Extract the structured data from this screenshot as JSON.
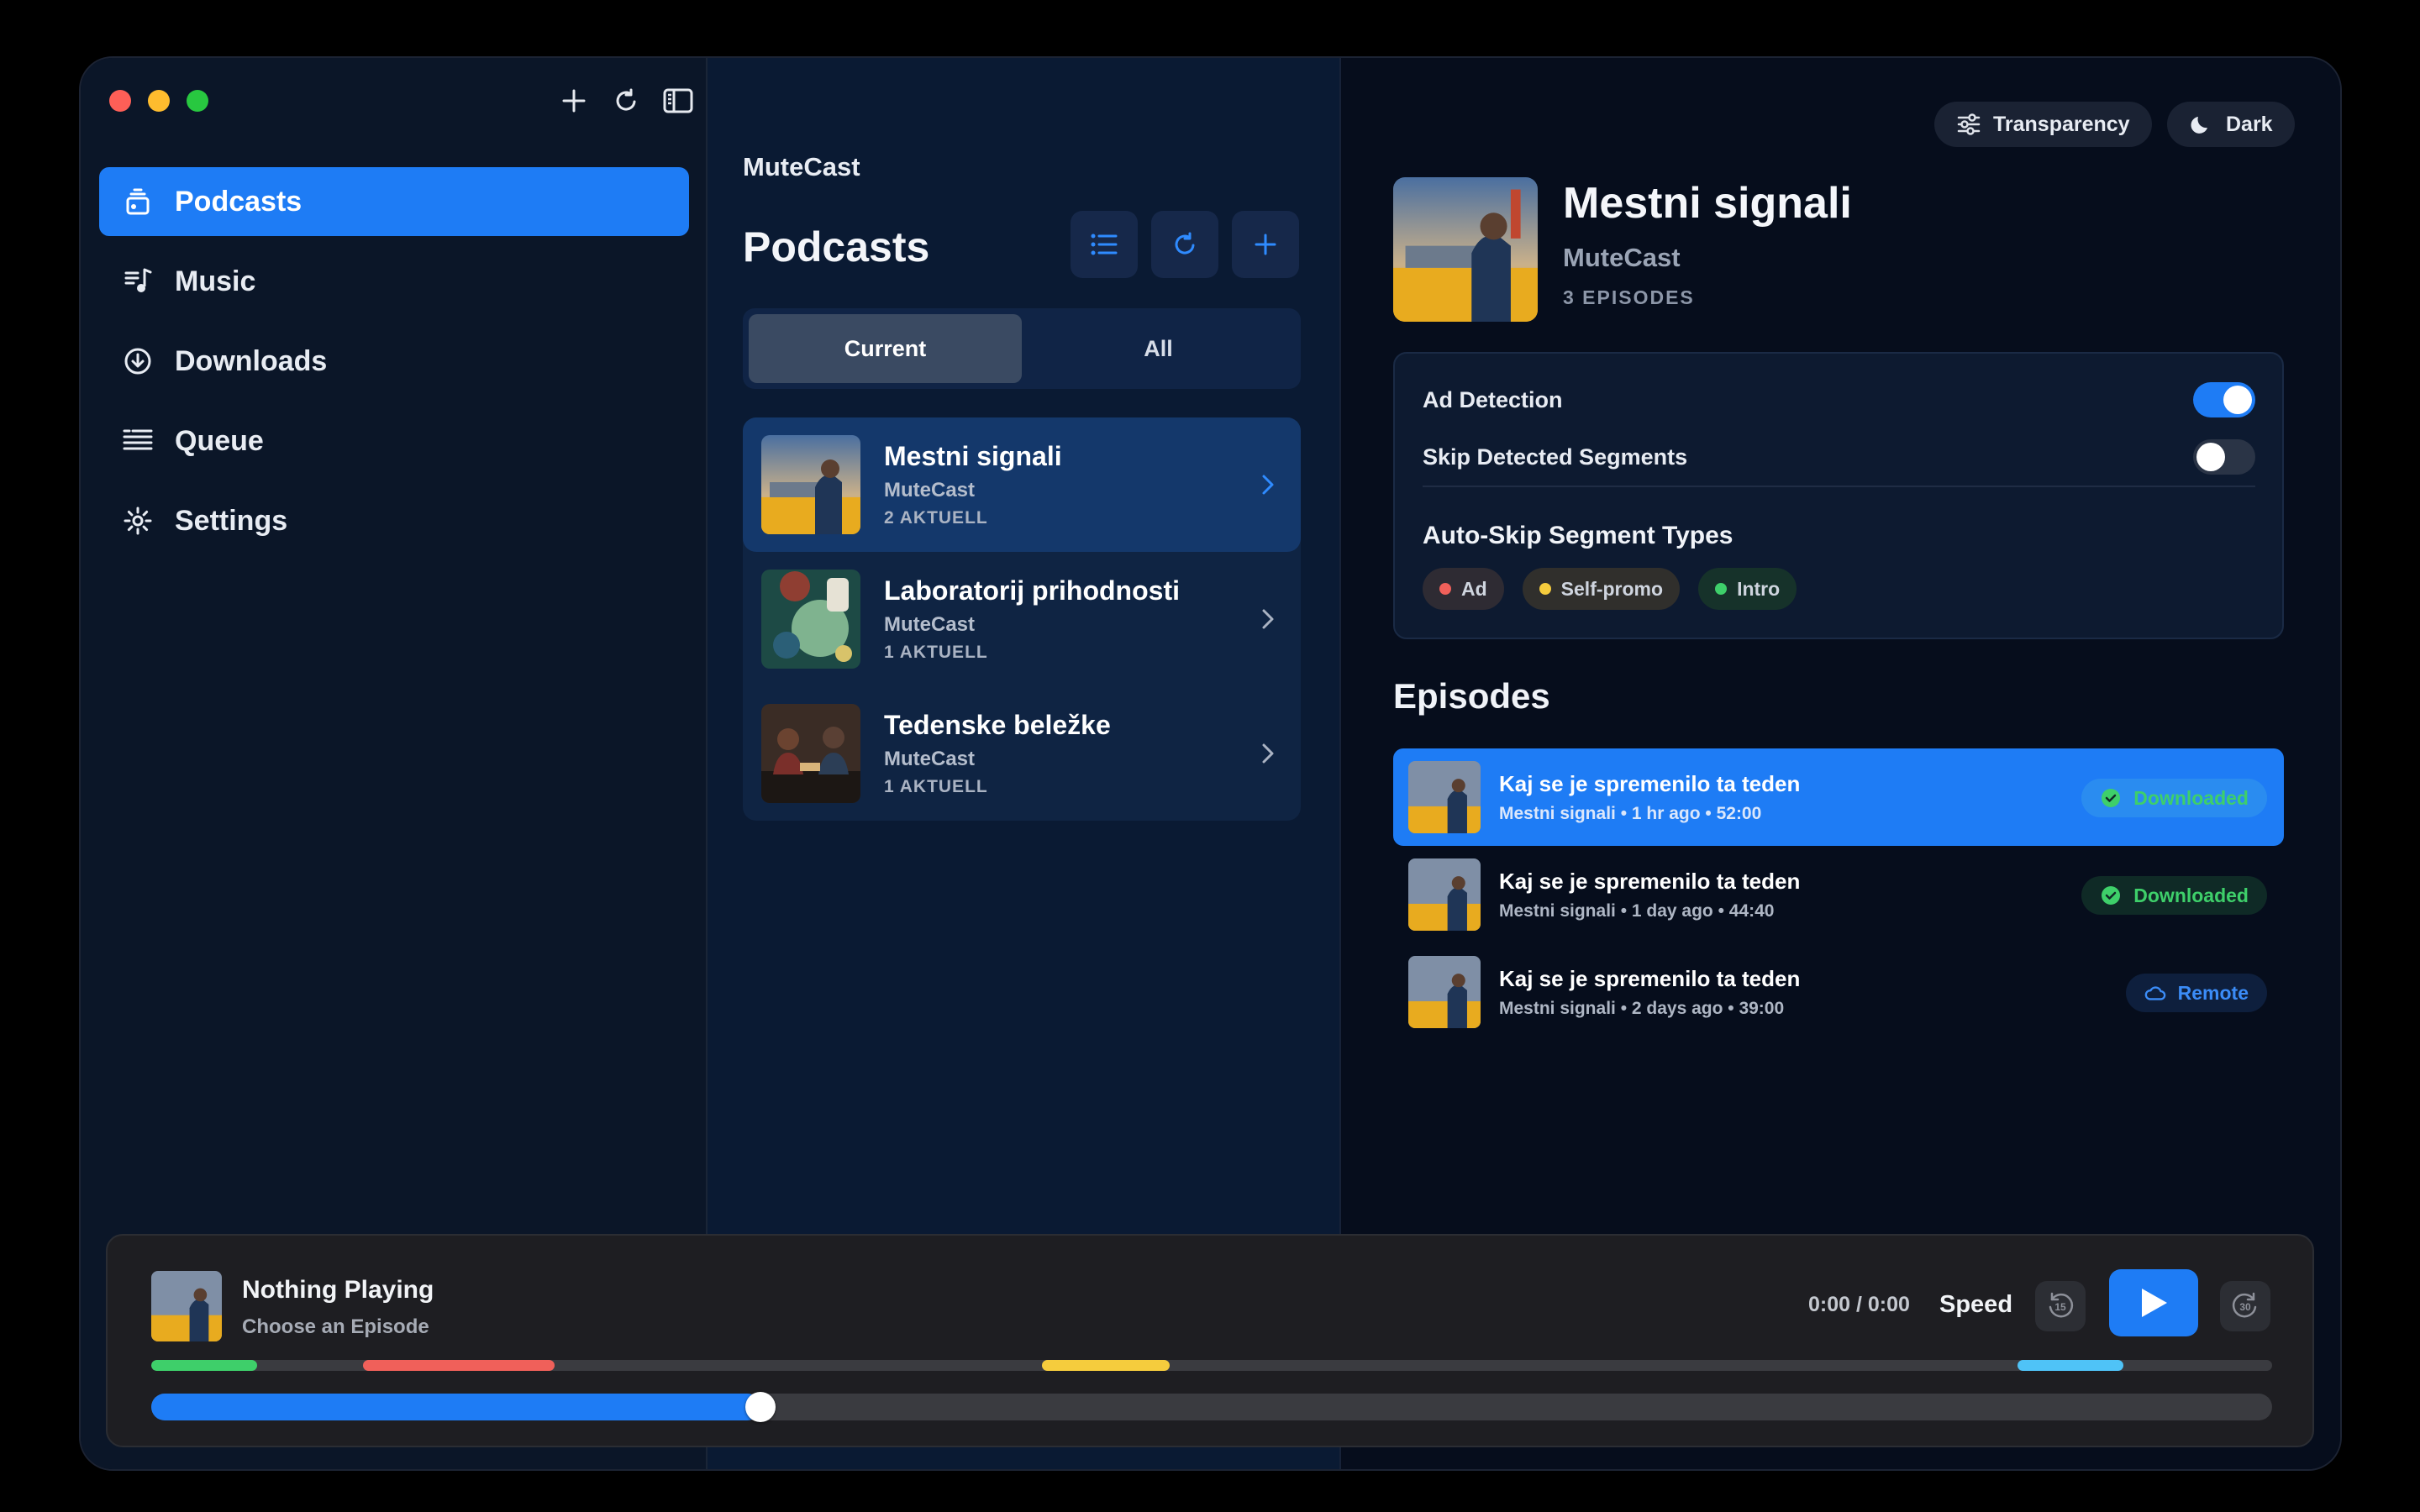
{
  "colors": {
    "accent": "#1e7cf5",
    "downloaded": "#3ecf6a",
    "remote": "#3b8cf7"
  },
  "sidebar": {
    "tools": [
      "plus-icon",
      "refresh-icon",
      "sidebar-toggle-icon"
    ],
    "items": [
      {
        "label": "Podcasts",
        "icon": "podcasts-icon",
        "active": true
      },
      {
        "label": "Music",
        "icon": "music-icon",
        "active": false
      },
      {
        "label": "Downloads",
        "icon": "downloads-icon",
        "active": false
      },
      {
        "label": "Queue",
        "icon": "queue-icon",
        "active": false
      },
      {
        "label": "Settings",
        "icon": "gear-icon",
        "active": false
      }
    ]
  },
  "middle": {
    "app_name": "MuteCast",
    "title": "Podcasts",
    "tabs": [
      {
        "label": "Current",
        "active": true
      },
      {
        "label": "All",
        "active": false
      }
    ],
    "podcasts": [
      {
        "title": "Mestni signali",
        "author": "MuteCast",
        "count": "2 AKTUELL",
        "active": true
      },
      {
        "title": "Laboratorij prihodnosti",
        "author": "MuteCast",
        "count": "1 AKTUELL",
        "active": false
      },
      {
        "title": "Tedenske beležke",
        "author": "MuteCast",
        "count": "1 AKTUELL",
        "active": false
      }
    ]
  },
  "detail": {
    "transparency_label": "Transparency",
    "dark_label": "Dark",
    "title": "Mestni signali",
    "author": "MuteCast",
    "episode_count": "3 EPISODES",
    "settings": {
      "ad_detection": {
        "label": "Ad Detection",
        "on": true
      },
      "skip_segments": {
        "label": "Skip Detected Segments",
        "on": false
      },
      "auto_skip_title": "Auto-Skip Segment Types",
      "segment_types": [
        {
          "label": "Ad",
          "color": "#f0605a"
        },
        {
          "label": "Self-promo",
          "color": "#f5cc3d"
        },
        {
          "label": "Intro",
          "color": "#3ecf6a"
        }
      ]
    },
    "episodes_title": "Episodes",
    "episodes": [
      {
        "title": "Kaj se je spremenilo ta teden",
        "meta": "Mestni signali • 1 hr ago • 52:00",
        "status": "Downloaded",
        "kind": "dl",
        "active": true
      },
      {
        "title": "Kaj se je spremenilo ta teden",
        "meta": "Mestni signali • 1 day ago • 44:40",
        "status": "Downloaded",
        "kind": "dl",
        "active": false
      },
      {
        "title": "Kaj se je spremenilo ta teden",
        "meta": "Mestni signali • 2 days ago • 39:00",
        "status": "Remote",
        "kind": "remote",
        "active": false
      }
    ]
  },
  "player": {
    "title": "Nothing Playing",
    "subtitle": "Choose an Episode",
    "time": "0:00 / 0:00",
    "speed_label": "Speed",
    "skip_back": "15",
    "skip_forward": "30",
    "progress": 0.28,
    "segments": [
      {
        "start": 0.0,
        "end": 0.05,
        "color": "#3ecf6a"
      },
      {
        "start": 0.1,
        "end": 0.19,
        "color": "#f0605a"
      },
      {
        "start": 0.42,
        "end": 0.48,
        "color": "#f5cc3d"
      },
      {
        "start": 0.88,
        "end": 0.93,
        "color": "#4fc3f7"
      }
    ]
  }
}
